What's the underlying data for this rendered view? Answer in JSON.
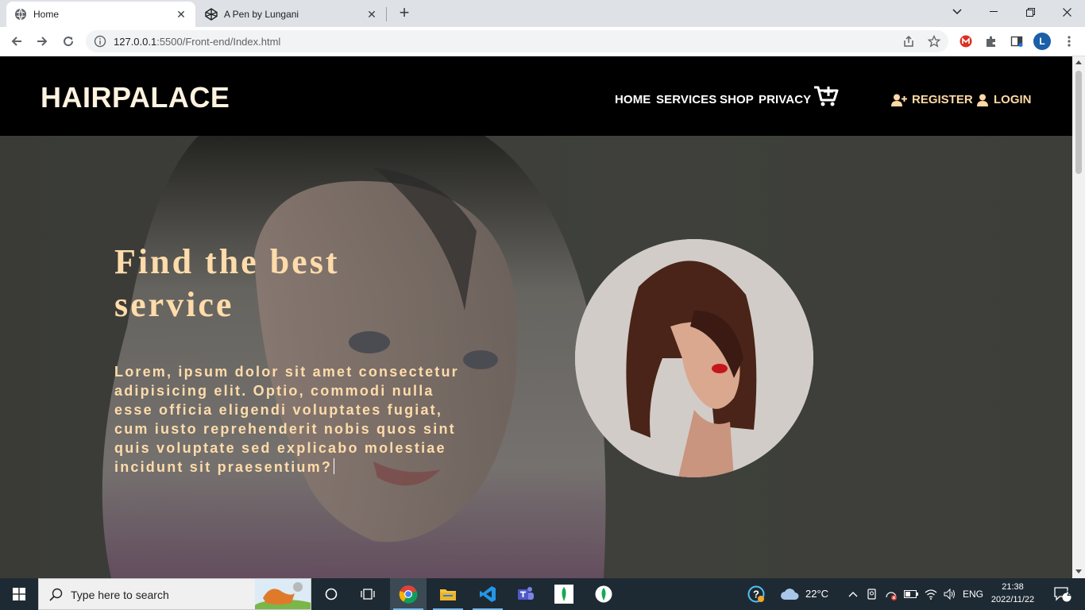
{
  "browser": {
    "tabs": [
      {
        "title": "Home"
      },
      {
        "title": "A Pen by Lungani"
      }
    ],
    "address": {
      "host": "127.0.0.1",
      "rest": ":5500/Front-end/Index.html"
    },
    "profile_initial": "L"
  },
  "site": {
    "brand": "HAIRPALACE",
    "nav": {
      "home": "HOME",
      "services": "SERVICES",
      "shop": "SHOP",
      "privacy": "PRIVACY"
    },
    "register": "REGISTER",
    "login": "LOGIN",
    "hero_title": "Find the best service",
    "hero_text": "Lorem, ipsum dolor sit amet consectetur adipisicing elit. Optio, commodi nulla esse officia eligendi voluptates fugiat, cum iusto reprehenderit nobis quos sint quis voluptate sed explicabo molestiae incidunt sit praesentium?"
  },
  "taskbar": {
    "search_placeholder": "Type here to search",
    "weather": "22°C",
    "lang": "ENG",
    "time": "21:38",
    "date": "2022/11/22",
    "notifications": "2"
  },
  "colors": {
    "accent": "#ffdcaa",
    "nav_bg": "#000000",
    "hero_bg": "#3c3d38"
  }
}
